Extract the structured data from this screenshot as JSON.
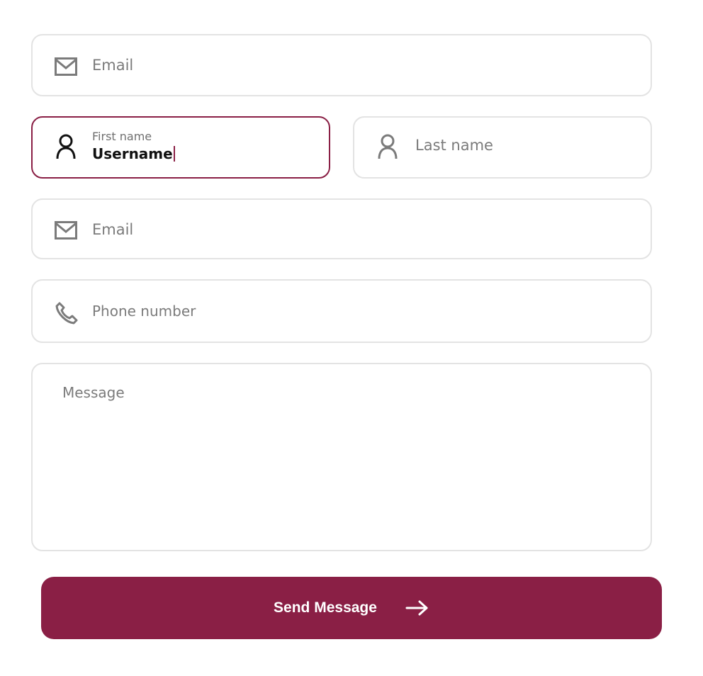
{
  "form": {
    "email_top": {
      "placeholder": "Email",
      "icon": "mail-icon"
    },
    "first_name": {
      "label": "First name",
      "value": "Username",
      "icon": "user-icon",
      "state": "focused"
    },
    "last_name": {
      "placeholder": "Last name",
      "icon": "user-icon"
    },
    "email": {
      "placeholder": "Email",
      "icon": "mail-icon"
    },
    "phone": {
      "placeholder": "Phone number",
      "icon": "phone-icon"
    },
    "message": {
      "placeholder": "Message"
    },
    "submit": {
      "label": "Send Message",
      "icon": "arrow-right-icon"
    }
  },
  "colors": {
    "accent": "#8a1f45",
    "border": "#e3e3e3",
    "placeholder": "#7b7b7b",
    "icon": "#7b7b7b",
    "active_icon": "#111111"
  }
}
